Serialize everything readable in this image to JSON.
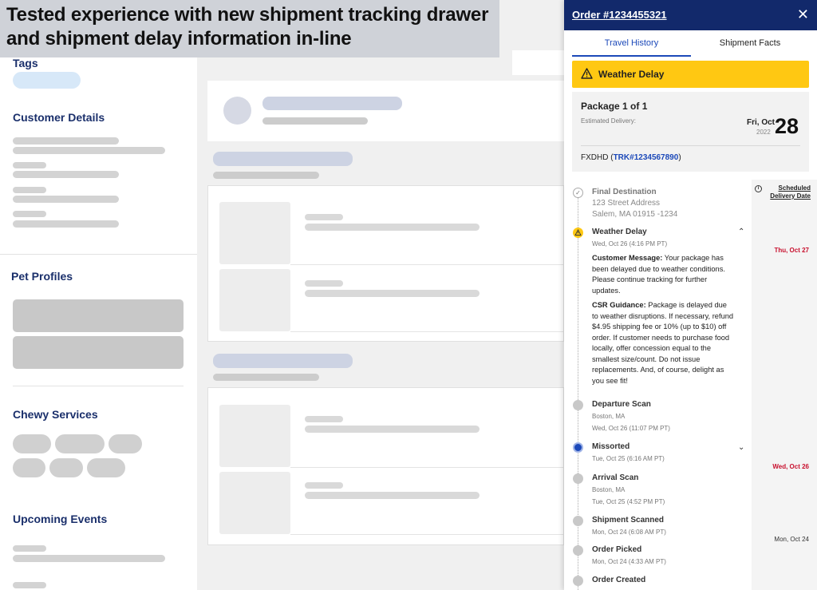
{
  "banner": {
    "line1": "Tested experience with new shipment tracking drawer",
    "line2": "and shipment delay information in-line"
  },
  "sidebar": {
    "tags_label": "Tags",
    "customer_details_label": "Customer Details",
    "pet_profiles_label": "Pet Profiles",
    "chewy_services_label": "Chewy Services",
    "upcoming_events_label": "Upcoming Events"
  },
  "drawer": {
    "order_link": "Order #1234455321",
    "close_icon": "close-icon",
    "tabs": [
      "Travel History",
      "Shipment Facts"
    ],
    "active_tab": "Travel History",
    "alert": {
      "label": "Weather Delay",
      "color": "#ffc812"
    },
    "package": {
      "title": "Package 1 of 1",
      "estimated_label": "Estimated Delivery:",
      "dow_month": "Fri, Oct",
      "year": "2022",
      "day": "28",
      "carrier": "FXDHD",
      "tracking_open": "(",
      "tracking": "TRK#1234567890",
      "tracking_close": ")"
    },
    "scheduled": {
      "header_line1": "Scheduled",
      "header_line2": "Delivery Date",
      "dates": [
        "Thu, Oct 27",
        "Wed, Oct 26",
        "Mon, Oct 24"
      ]
    },
    "events": [
      {
        "title": "Final Destination",
        "addr1": "123 Street Address",
        "addr2": "Salem, MA 01915 -1234"
      },
      {
        "title": "Weather Delay",
        "time": "Wed, Oct 26 (4:16 PM PT)",
        "customer_label": "Customer Message:",
        "customer_text": " Your package has been delayed due to weather conditions. Please continue tracking for further updates.",
        "csr_label": "CSR Guidance:",
        "csr_text": " Package is delayed due to weather disruptions. If necessary, refund $4.95 shipping fee or 10% (up to $10) off order. If customer needs to purchase food locally, offer concession equal to the smallest size/count. Do not issue replacements. And, of course, delight as you see fit!"
      },
      {
        "title": "Departure Scan",
        "loc": "Boston, MA",
        "time": "Wed, Oct 26 (11:07 PM PT)"
      },
      {
        "title": "Missorted",
        "time": "Tue, Oct 25 (6:16 AM PT)"
      },
      {
        "title": "Arrival Scan",
        "loc": "Boston, MA",
        "time": "Tue, Oct 25 (4:52 PM PT)"
      },
      {
        "title": "Shipment Scanned",
        "time": "Mon, Oct 24 (6:08 AM PT)"
      },
      {
        "title": "Order Picked",
        "time": "Mon, Oct 24 (4:33 AM PT)"
      },
      {
        "title": "Order Created"
      }
    ],
    "colors": {
      "header": "#12296b",
      "link": "#1c49b9",
      "delay_red": "#c8102e",
      "missort_blue": "#1c49b9"
    }
  }
}
